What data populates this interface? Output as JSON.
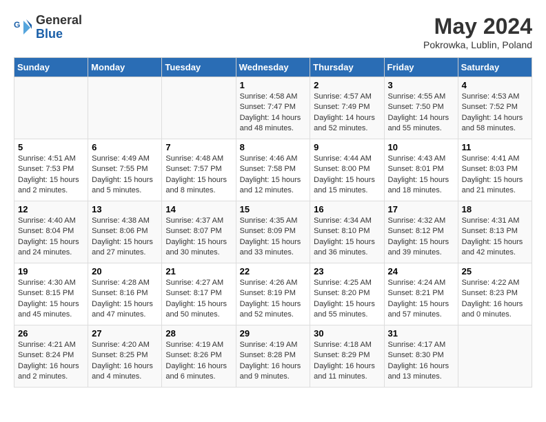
{
  "header": {
    "logo_line1": "General",
    "logo_line2": "Blue",
    "month_title": "May 2024",
    "subtitle": "Pokrowka, Lublin, Poland"
  },
  "days_of_week": [
    "Sunday",
    "Monday",
    "Tuesday",
    "Wednesday",
    "Thursday",
    "Friday",
    "Saturday"
  ],
  "weeks": [
    [
      {
        "day": "",
        "info": ""
      },
      {
        "day": "",
        "info": ""
      },
      {
        "day": "",
        "info": ""
      },
      {
        "day": "1",
        "info": "Sunrise: 4:58 AM\nSunset: 7:47 PM\nDaylight: 14 hours\nand 48 minutes."
      },
      {
        "day": "2",
        "info": "Sunrise: 4:57 AM\nSunset: 7:49 PM\nDaylight: 14 hours\nand 52 minutes."
      },
      {
        "day": "3",
        "info": "Sunrise: 4:55 AM\nSunset: 7:50 PM\nDaylight: 14 hours\nand 55 minutes."
      },
      {
        "day": "4",
        "info": "Sunrise: 4:53 AM\nSunset: 7:52 PM\nDaylight: 14 hours\nand 58 minutes."
      }
    ],
    [
      {
        "day": "5",
        "info": "Sunrise: 4:51 AM\nSunset: 7:53 PM\nDaylight: 15 hours\nand 2 minutes."
      },
      {
        "day": "6",
        "info": "Sunrise: 4:49 AM\nSunset: 7:55 PM\nDaylight: 15 hours\nand 5 minutes."
      },
      {
        "day": "7",
        "info": "Sunrise: 4:48 AM\nSunset: 7:57 PM\nDaylight: 15 hours\nand 8 minutes."
      },
      {
        "day": "8",
        "info": "Sunrise: 4:46 AM\nSunset: 7:58 PM\nDaylight: 15 hours\nand 12 minutes."
      },
      {
        "day": "9",
        "info": "Sunrise: 4:44 AM\nSunset: 8:00 PM\nDaylight: 15 hours\nand 15 minutes."
      },
      {
        "day": "10",
        "info": "Sunrise: 4:43 AM\nSunset: 8:01 PM\nDaylight: 15 hours\nand 18 minutes."
      },
      {
        "day": "11",
        "info": "Sunrise: 4:41 AM\nSunset: 8:03 PM\nDaylight: 15 hours\nand 21 minutes."
      }
    ],
    [
      {
        "day": "12",
        "info": "Sunrise: 4:40 AM\nSunset: 8:04 PM\nDaylight: 15 hours\nand 24 minutes."
      },
      {
        "day": "13",
        "info": "Sunrise: 4:38 AM\nSunset: 8:06 PM\nDaylight: 15 hours\nand 27 minutes."
      },
      {
        "day": "14",
        "info": "Sunrise: 4:37 AM\nSunset: 8:07 PM\nDaylight: 15 hours\nand 30 minutes."
      },
      {
        "day": "15",
        "info": "Sunrise: 4:35 AM\nSunset: 8:09 PM\nDaylight: 15 hours\nand 33 minutes."
      },
      {
        "day": "16",
        "info": "Sunrise: 4:34 AM\nSunset: 8:10 PM\nDaylight: 15 hours\nand 36 minutes."
      },
      {
        "day": "17",
        "info": "Sunrise: 4:32 AM\nSunset: 8:12 PM\nDaylight: 15 hours\nand 39 minutes."
      },
      {
        "day": "18",
        "info": "Sunrise: 4:31 AM\nSunset: 8:13 PM\nDaylight: 15 hours\nand 42 minutes."
      }
    ],
    [
      {
        "day": "19",
        "info": "Sunrise: 4:30 AM\nSunset: 8:15 PM\nDaylight: 15 hours\nand 45 minutes."
      },
      {
        "day": "20",
        "info": "Sunrise: 4:28 AM\nSunset: 8:16 PM\nDaylight: 15 hours\nand 47 minutes."
      },
      {
        "day": "21",
        "info": "Sunrise: 4:27 AM\nSunset: 8:17 PM\nDaylight: 15 hours\nand 50 minutes."
      },
      {
        "day": "22",
        "info": "Sunrise: 4:26 AM\nSunset: 8:19 PM\nDaylight: 15 hours\nand 52 minutes."
      },
      {
        "day": "23",
        "info": "Sunrise: 4:25 AM\nSunset: 8:20 PM\nDaylight: 15 hours\nand 55 minutes."
      },
      {
        "day": "24",
        "info": "Sunrise: 4:24 AM\nSunset: 8:21 PM\nDaylight: 15 hours\nand 57 minutes."
      },
      {
        "day": "25",
        "info": "Sunrise: 4:22 AM\nSunset: 8:23 PM\nDaylight: 16 hours\nand 0 minutes."
      }
    ],
    [
      {
        "day": "26",
        "info": "Sunrise: 4:21 AM\nSunset: 8:24 PM\nDaylight: 16 hours\nand 2 minutes."
      },
      {
        "day": "27",
        "info": "Sunrise: 4:20 AM\nSunset: 8:25 PM\nDaylight: 16 hours\nand 4 minutes."
      },
      {
        "day": "28",
        "info": "Sunrise: 4:19 AM\nSunset: 8:26 PM\nDaylight: 16 hours\nand 6 minutes."
      },
      {
        "day": "29",
        "info": "Sunrise: 4:19 AM\nSunset: 8:28 PM\nDaylight: 16 hours\nand 9 minutes."
      },
      {
        "day": "30",
        "info": "Sunrise: 4:18 AM\nSunset: 8:29 PM\nDaylight: 16 hours\nand 11 minutes."
      },
      {
        "day": "31",
        "info": "Sunrise: 4:17 AM\nSunset: 8:30 PM\nDaylight: 16 hours\nand 13 minutes."
      },
      {
        "day": "",
        "info": ""
      }
    ]
  ]
}
